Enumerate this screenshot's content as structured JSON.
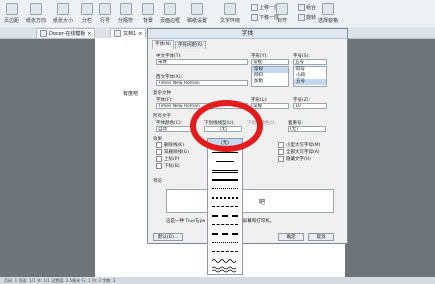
{
  "toolbar": {
    "items": [
      "页边距",
      "纸张方向",
      "纸张大小",
      "分栏",
      "行号",
      "分隔符",
      "背景",
      "页面边框",
      "稿纸设置",
      "文字环绕",
      "对齐",
      "旋转",
      "选择窗格"
    ],
    "small": [
      "上移一层",
      "下移一层",
      "组合"
    ]
  },
  "tabs": {
    "doc1": "Docer-在线模板",
    "doc2": "文档1"
  },
  "page": {
    "text": "有度吧"
  },
  "dialog": {
    "title": "字体",
    "tab_font": "字体(N)",
    "tab_spacing": "字符间距(R)",
    "cn_font_label": "中文字体(T):",
    "cn_font_value": "宋体",
    "style_label": "字形(Y):",
    "style_value": "常规",
    "size_label": "字号(S):",
    "size_value": "五号",
    "west_font_label": "西文字体(X):",
    "west_font_value": "Times New Roman",
    "styles": [
      "常规",
      "倾斜",
      "加粗"
    ],
    "sizes": [
      "四号",
      "小四",
      "五号"
    ],
    "complex_label": "复杂文种",
    "complex_font_label": "字体(F):",
    "complex_font_value": "Times New Roman",
    "complex_style_label": "字形(L):",
    "complex_style_value": "常规",
    "complex_size_label": "字号(Z):",
    "complex_size_value": "10",
    "all_text_label": "所有文字",
    "font_color_label": "字体颜色(C):",
    "font_color_value": "自动",
    "underline_label": "下划线线型(U):",
    "underline_value": "(无)",
    "underline_color_label": "下划线颜色(I):",
    "emphasis_label": "着重号:",
    "emphasis_value": "(无)",
    "effects_label": "效果",
    "effects_left": [
      "删除线(K)",
      "双删除线(G)",
      "上标(P)",
      "下标(B)"
    ],
    "effects_right": [
      "小型大写字母(M)",
      "全部大写字母(A)",
      "隐藏文字(H)"
    ],
    "preview_label": "预览",
    "preview_text": "吧",
    "note": "这是一种 TrueType 字体，同时适用于屏幕和打印机。",
    "default_button": "默认(D)...",
    "ok_button": "确定",
    "cancel_button": "取消"
  },
  "dropdown": {
    "selected": "(无)"
  },
  "statusbar": {
    "text": "页码: 1  页面: 1/1  节: 1/1  设置值: 2.5厘米  行: 1  列: 3  字数: 3"
  }
}
